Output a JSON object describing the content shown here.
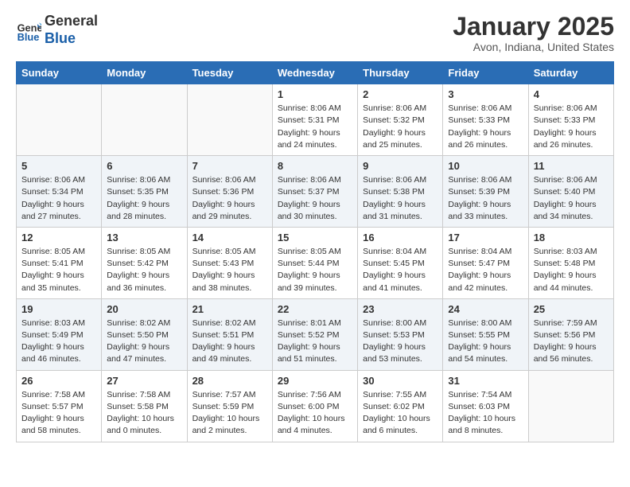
{
  "header": {
    "logo_line1": "General",
    "logo_line2": "Blue",
    "month": "January 2025",
    "location": "Avon, Indiana, United States"
  },
  "weekdays": [
    "Sunday",
    "Monday",
    "Tuesday",
    "Wednesday",
    "Thursday",
    "Friday",
    "Saturday"
  ],
  "weeks": [
    [
      {
        "day": "",
        "detail": ""
      },
      {
        "day": "",
        "detail": ""
      },
      {
        "day": "",
        "detail": ""
      },
      {
        "day": "1",
        "detail": "Sunrise: 8:06 AM\nSunset: 5:31 PM\nDaylight: 9 hours\nand 24 minutes."
      },
      {
        "day": "2",
        "detail": "Sunrise: 8:06 AM\nSunset: 5:32 PM\nDaylight: 9 hours\nand 25 minutes."
      },
      {
        "day": "3",
        "detail": "Sunrise: 8:06 AM\nSunset: 5:33 PM\nDaylight: 9 hours\nand 26 minutes."
      },
      {
        "day": "4",
        "detail": "Sunrise: 8:06 AM\nSunset: 5:33 PM\nDaylight: 9 hours\nand 26 minutes."
      }
    ],
    [
      {
        "day": "5",
        "detail": "Sunrise: 8:06 AM\nSunset: 5:34 PM\nDaylight: 9 hours\nand 27 minutes."
      },
      {
        "day": "6",
        "detail": "Sunrise: 8:06 AM\nSunset: 5:35 PM\nDaylight: 9 hours\nand 28 minutes."
      },
      {
        "day": "7",
        "detail": "Sunrise: 8:06 AM\nSunset: 5:36 PM\nDaylight: 9 hours\nand 29 minutes."
      },
      {
        "day": "8",
        "detail": "Sunrise: 8:06 AM\nSunset: 5:37 PM\nDaylight: 9 hours\nand 30 minutes."
      },
      {
        "day": "9",
        "detail": "Sunrise: 8:06 AM\nSunset: 5:38 PM\nDaylight: 9 hours\nand 31 minutes."
      },
      {
        "day": "10",
        "detail": "Sunrise: 8:06 AM\nSunset: 5:39 PM\nDaylight: 9 hours\nand 33 minutes."
      },
      {
        "day": "11",
        "detail": "Sunrise: 8:06 AM\nSunset: 5:40 PM\nDaylight: 9 hours\nand 34 minutes."
      }
    ],
    [
      {
        "day": "12",
        "detail": "Sunrise: 8:05 AM\nSunset: 5:41 PM\nDaylight: 9 hours\nand 35 minutes."
      },
      {
        "day": "13",
        "detail": "Sunrise: 8:05 AM\nSunset: 5:42 PM\nDaylight: 9 hours\nand 36 minutes."
      },
      {
        "day": "14",
        "detail": "Sunrise: 8:05 AM\nSunset: 5:43 PM\nDaylight: 9 hours\nand 38 minutes."
      },
      {
        "day": "15",
        "detail": "Sunrise: 8:05 AM\nSunset: 5:44 PM\nDaylight: 9 hours\nand 39 minutes."
      },
      {
        "day": "16",
        "detail": "Sunrise: 8:04 AM\nSunset: 5:45 PM\nDaylight: 9 hours\nand 41 minutes."
      },
      {
        "day": "17",
        "detail": "Sunrise: 8:04 AM\nSunset: 5:47 PM\nDaylight: 9 hours\nand 42 minutes."
      },
      {
        "day": "18",
        "detail": "Sunrise: 8:03 AM\nSunset: 5:48 PM\nDaylight: 9 hours\nand 44 minutes."
      }
    ],
    [
      {
        "day": "19",
        "detail": "Sunrise: 8:03 AM\nSunset: 5:49 PM\nDaylight: 9 hours\nand 46 minutes."
      },
      {
        "day": "20",
        "detail": "Sunrise: 8:02 AM\nSunset: 5:50 PM\nDaylight: 9 hours\nand 47 minutes."
      },
      {
        "day": "21",
        "detail": "Sunrise: 8:02 AM\nSunset: 5:51 PM\nDaylight: 9 hours\nand 49 minutes."
      },
      {
        "day": "22",
        "detail": "Sunrise: 8:01 AM\nSunset: 5:52 PM\nDaylight: 9 hours\nand 51 minutes."
      },
      {
        "day": "23",
        "detail": "Sunrise: 8:00 AM\nSunset: 5:53 PM\nDaylight: 9 hours\nand 53 minutes."
      },
      {
        "day": "24",
        "detail": "Sunrise: 8:00 AM\nSunset: 5:55 PM\nDaylight: 9 hours\nand 54 minutes."
      },
      {
        "day": "25",
        "detail": "Sunrise: 7:59 AM\nSunset: 5:56 PM\nDaylight: 9 hours\nand 56 minutes."
      }
    ],
    [
      {
        "day": "26",
        "detail": "Sunrise: 7:58 AM\nSunset: 5:57 PM\nDaylight: 9 hours\nand 58 minutes."
      },
      {
        "day": "27",
        "detail": "Sunrise: 7:58 AM\nSunset: 5:58 PM\nDaylight: 10 hours\nand 0 minutes."
      },
      {
        "day": "28",
        "detail": "Sunrise: 7:57 AM\nSunset: 5:59 PM\nDaylight: 10 hours\nand 2 minutes."
      },
      {
        "day": "29",
        "detail": "Sunrise: 7:56 AM\nSunset: 6:00 PM\nDaylight: 10 hours\nand 4 minutes."
      },
      {
        "day": "30",
        "detail": "Sunrise: 7:55 AM\nSunset: 6:02 PM\nDaylight: 10 hours\nand 6 minutes."
      },
      {
        "day": "31",
        "detail": "Sunrise: 7:54 AM\nSunset: 6:03 PM\nDaylight: 10 hours\nand 8 minutes."
      },
      {
        "day": "",
        "detail": ""
      }
    ]
  ]
}
